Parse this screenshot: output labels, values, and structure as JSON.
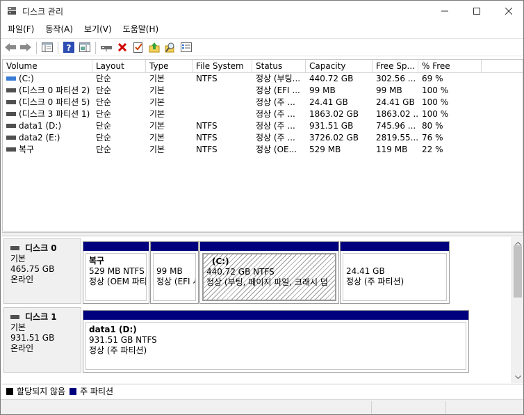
{
  "window": {
    "title": "디스크 관리"
  },
  "menu": [
    "파일(F)",
    "동작(A)",
    "보기(V)",
    "도움말(H)"
  ],
  "toolbar": {
    "icons": [
      "back-arrow-icon",
      "forward-arrow-icon",
      "show-hide-console-tree-icon",
      "help-icon",
      "action-pane-icon",
      "connect-drive-icon",
      "delete-icon",
      "check-properties-icon",
      "up-level-icon",
      "search-icon",
      "console-list-icon"
    ]
  },
  "volume_list": {
    "columns": [
      "Volume",
      "Layout",
      "Type",
      "File System",
      "Status",
      "Capacity",
      "Free Sp...",
      "% Free"
    ],
    "rows": [
      {
        "volume": "(C:)",
        "layout": "단순",
        "type": "기본",
        "fs": "NTFS",
        "status": "정상 (부팅...",
        "capacity": "440.72 GB",
        "free": "302.56 ...",
        "pct": "69 %",
        "icon_color": "#3a7bd5"
      },
      {
        "volume": "(디스크 0 파티션 2)",
        "layout": "단순",
        "type": "기본",
        "fs": "",
        "status": "정상 (EFI ...",
        "capacity": "99 MB",
        "free": "99 MB",
        "pct": "100 %",
        "icon_color": "#505050"
      },
      {
        "volume": "(디스크 0 파티션 5)",
        "layout": "단순",
        "type": "기본",
        "fs": "",
        "status": "정상 (주 ...",
        "capacity": "24.41 GB",
        "free": "24.41 GB",
        "pct": "100 %",
        "icon_color": "#505050"
      },
      {
        "volume": "(디스크 3 파티션 1)",
        "layout": "단순",
        "type": "기본",
        "fs": "",
        "status": "정상 (주 ...",
        "capacity": "1863.02 GB",
        "free": "1863.02 ...",
        "pct": "100 %",
        "icon_color": "#505050"
      },
      {
        "volume": "data1 (D:)",
        "layout": "단순",
        "type": "기본",
        "fs": "NTFS",
        "status": "정상 (주 ...",
        "capacity": "931.51 GB",
        "free": "745.96 ...",
        "pct": "80 %",
        "icon_color": "#505050"
      },
      {
        "volume": "data2 (E:)",
        "layout": "단순",
        "type": "기본",
        "fs": "NTFS",
        "status": "정상 (주 ...",
        "capacity": "3726.02 GB",
        "free": "2819.55...",
        "pct": "76 %",
        "icon_color": "#505050"
      },
      {
        "volume": "복구",
        "layout": "단순",
        "type": "기본",
        "fs": "NTFS",
        "status": "정상 (OE...",
        "capacity": "529 MB",
        "free": "119 MB",
        "pct": "22 %",
        "icon_color": "#505050"
      }
    ]
  },
  "disks": [
    {
      "name": "디스크 0",
      "type": "기본",
      "size": "465.75 GB",
      "state": "온라인",
      "partitions": [
        {
          "name": "복구",
          "size": "529 MB NTFS",
          "status": "정상 (OEM 파티"
        },
        {
          "name": "",
          "size": "99 MB",
          "status": "정상 (EFI 시"
        },
        {
          "name": "(C:)",
          "size": "440.72 GB NTFS",
          "status": "정상 (부팅, 페이지 파일, 크래시 덤"
        },
        {
          "name": "",
          "size": "24.41 GB",
          "status": "정상 (주 파티션)"
        }
      ]
    },
    {
      "name": "디스크 1",
      "type": "기본",
      "size": "931.51 GB",
      "state": "온라인",
      "partitions": [
        {
          "name": "data1  (D:)",
          "size": "931.51 GB NTFS",
          "status": "정상 (주 파티션)"
        }
      ]
    }
  ],
  "legend": [
    {
      "label": "할당되지 않음",
      "color": "#000000"
    },
    {
      "label": "주 파티션",
      "color": "#00007f"
    }
  ]
}
